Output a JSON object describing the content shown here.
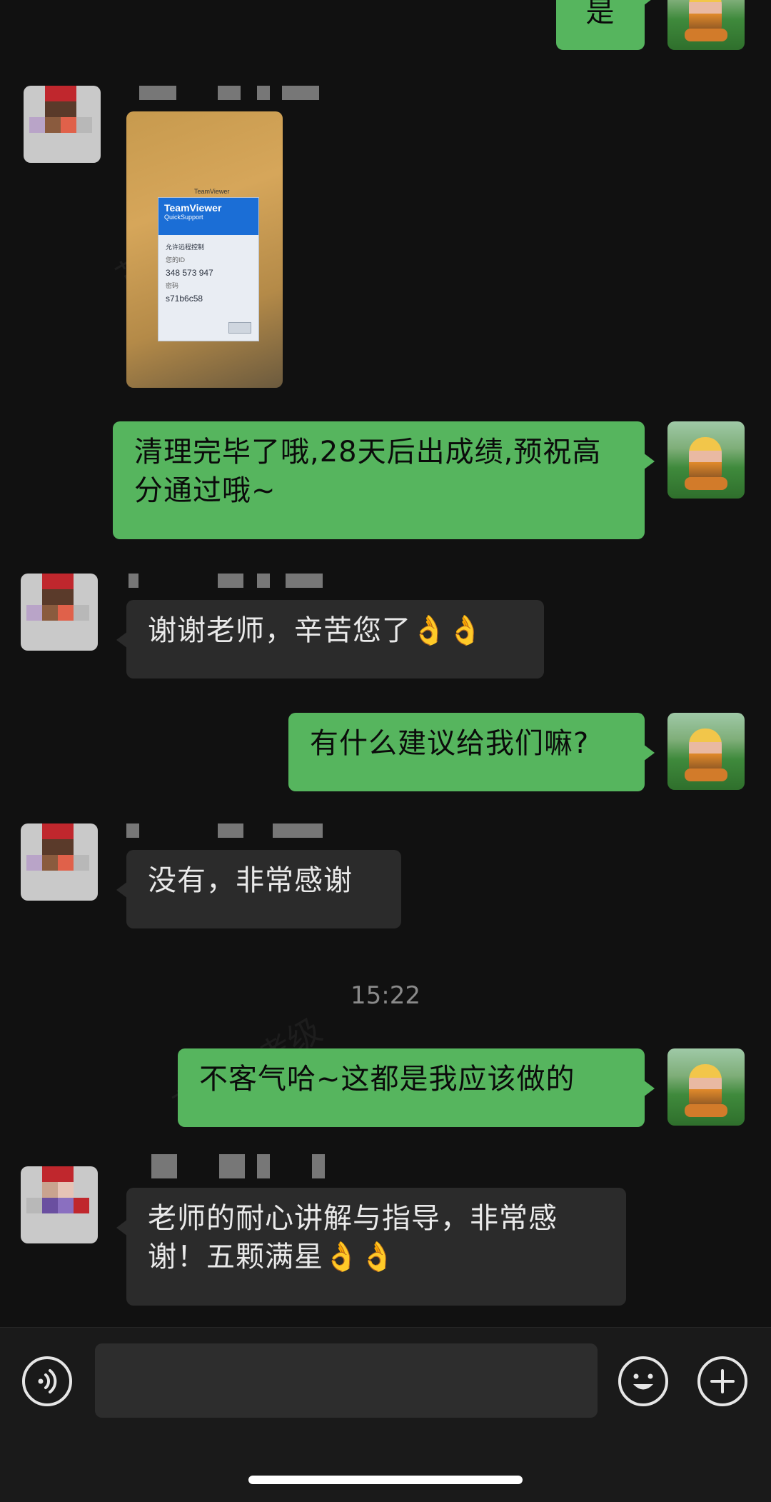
{
  "messages": [
    {
      "id": "m0",
      "side": "out",
      "text": "是"
    },
    {
      "id": "m1",
      "side": "in",
      "type": "image",
      "image": {
        "window_title": "TeamViewer",
        "brand": "TeamViewer",
        "subtitle": "QuickSupport",
        "allow_label": "允许远程控制",
        "id_label": "您的ID",
        "id_value": "348 573 947",
        "password_label": "密码",
        "password_value": "s71b6c58"
      }
    },
    {
      "id": "m2",
      "side": "out",
      "text": "清理完毕了哦,28天后出成绩,预祝高分通过哦~"
    },
    {
      "id": "m3",
      "side": "in",
      "text": "谢谢老师，辛苦您了",
      "emoji": "👌👌"
    },
    {
      "id": "m4",
      "side": "out",
      "text": "有什么建议给我们嘛?"
    },
    {
      "id": "m5",
      "side": "in",
      "text": "没有，非常感谢"
    },
    {
      "id": "m6",
      "side": "out",
      "text": "不客气哈~这都是我应该做的"
    },
    {
      "id": "m7",
      "side": "in",
      "text": "老师的耐心讲解与指导，非常感谢！五颗满星",
      "emoji": "👌👌"
    }
  ],
  "timestamp": "15:22",
  "watermark": "芷音乐考级",
  "input_bar": {
    "voice_icon": "voice-icon",
    "emoji_icon": "emoji-face-icon",
    "plus_icon": "plus-icon"
  },
  "colors": {
    "background": "#111111",
    "outgoing_bubble": "#56b55e",
    "incoming_bubble": "#2b2b2b"
  }
}
